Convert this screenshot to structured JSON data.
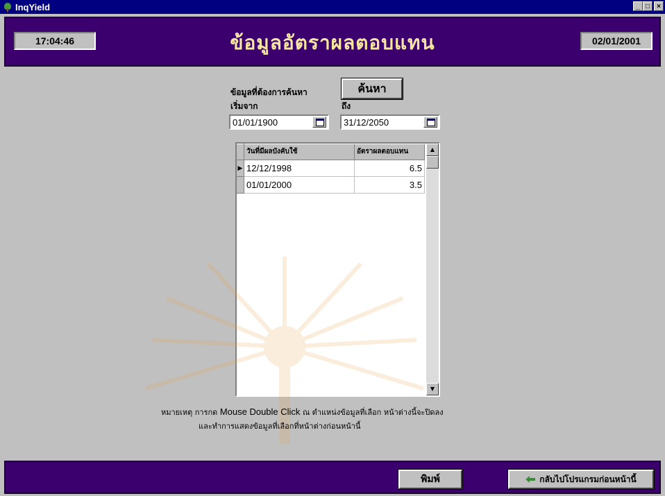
{
  "window": {
    "title": "InqYield",
    "minimize": "_",
    "maximize": "□",
    "close": "×"
  },
  "header": {
    "time": "17:04:46",
    "title": "ข้อมูลอัตราผลตอบแทน",
    "date": "02/01/2001"
  },
  "search": {
    "heading": "ข้อมูลที่ต้องการค้นหา",
    "from_label": "เริ่มจาก",
    "to_label": "ถึง",
    "button_label": "ค้นหา",
    "from_value": "01/01/1900",
    "to_value": "31/12/2050"
  },
  "grid": {
    "columns": [
      "วันที่มีผลบังคับใช้",
      "อัตราผลตอบแทน"
    ],
    "rows": [
      {
        "date": "12/12/1998",
        "rate": "6.5",
        "current": true
      },
      {
        "date": "01/01/2000",
        "rate": "3.5",
        "current": false
      }
    ]
  },
  "note": {
    "line1_prefix": "หมายเหตุ การกด",
    "line1_english": "Mouse  Double Click",
    "line1_suffix": "ณ ตำแหน่งข้อมูลที่เลือก หน้าต่างนี้จะปิดลง",
    "line2": "และทำการแสดงข้อมูลที่เลือกที่หน้าต่างก่อนหน้านี้"
  },
  "footer": {
    "print_label": "พิมพ์",
    "back_label": "กลับไปโปรแกรมก่อนหน้านี้"
  },
  "colors": {
    "panel_purple": "#3b006e",
    "title_yellow": "#f5e6a0",
    "titlebar_blue": "#000080"
  }
}
